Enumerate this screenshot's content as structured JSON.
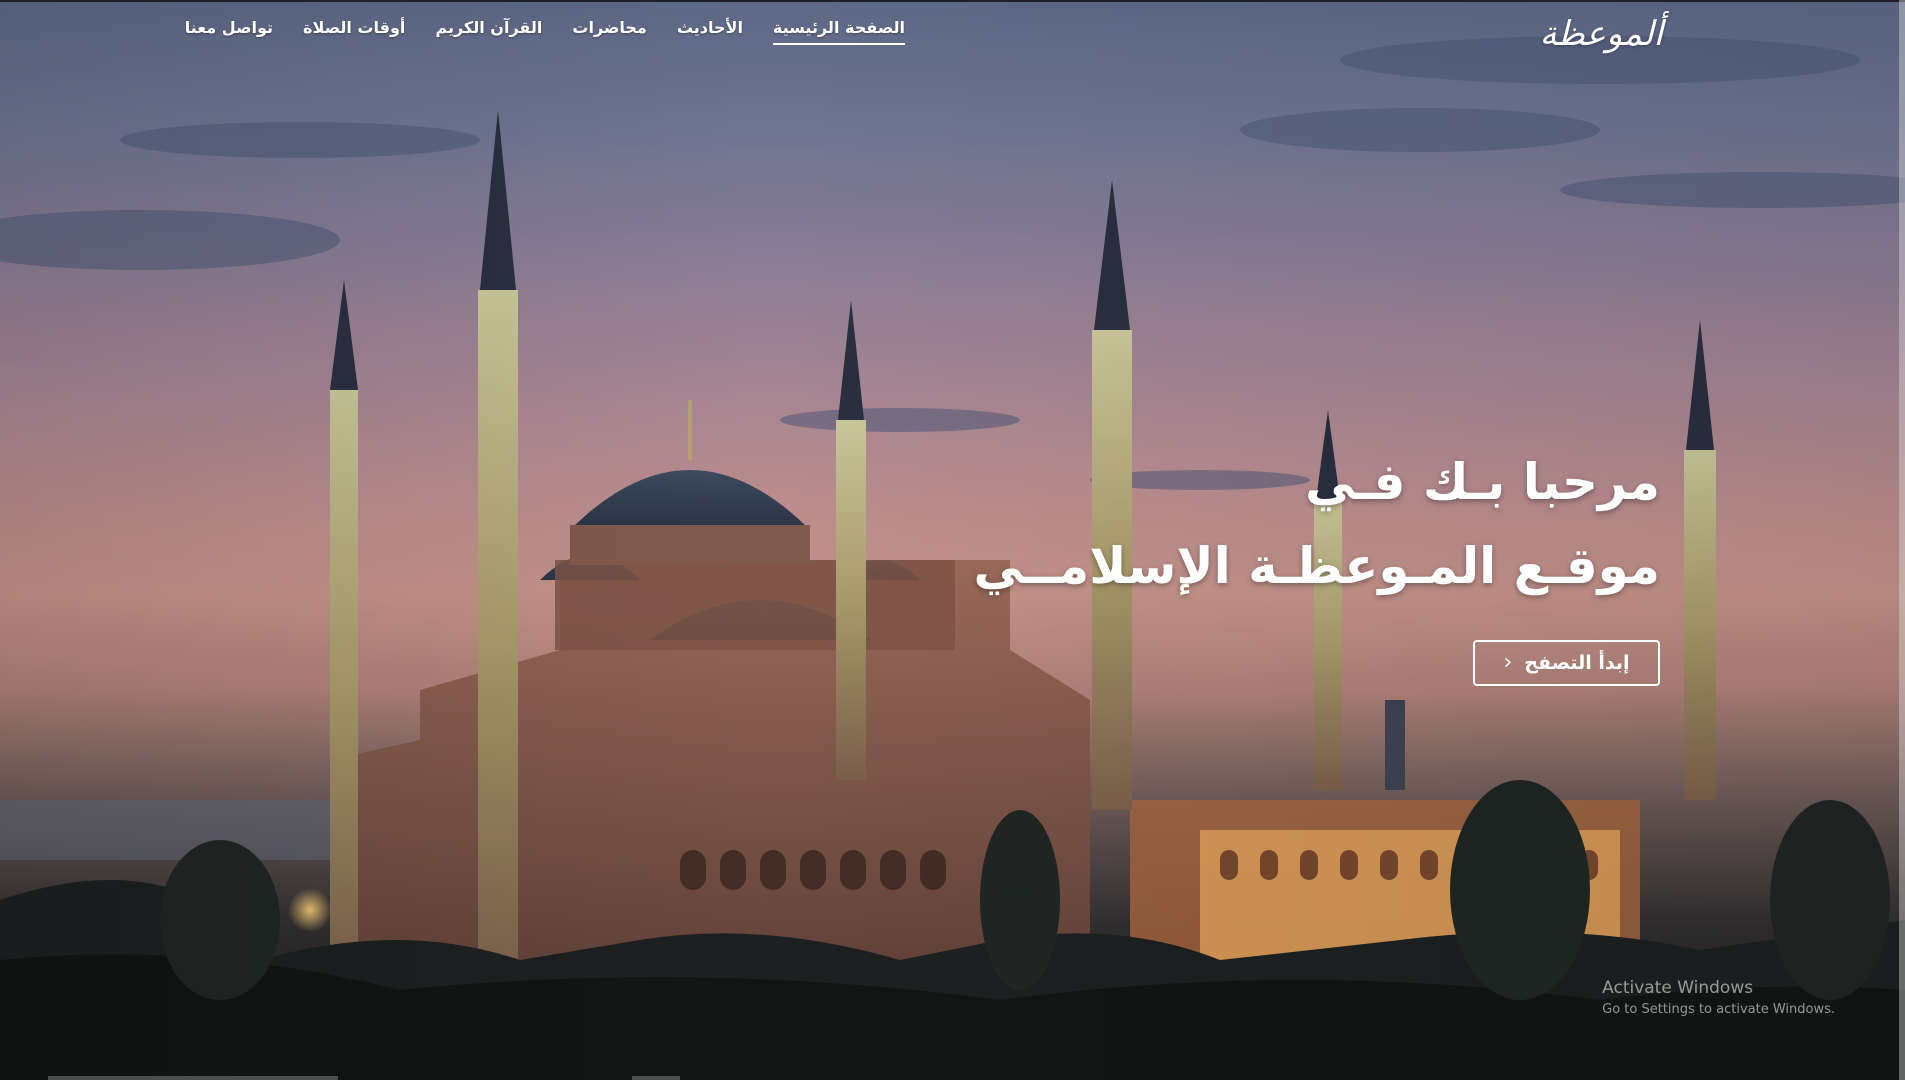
{
  "brand": {
    "logo_text": "ألموعظة"
  },
  "nav": {
    "items": [
      {
        "label": "الصفحة الرئيسية",
        "active": true
      },
      {
        "label": "الأحاديث",
        "active": false
      },
      {
        "label": "محاضرات",
        "active": false
      },
      {
        "label": "القرآن الكريم",
        "active": false
      },
      {
        "label": "أوقات الصلاة",
        "active": false
      },
      {
        "label": "تواصل معنا",
        "active": false
      }
    ]
  },
  "hero": {
    "title_line_1": "مرحبا بـك فـي",
    "title_line_2": "موقـع المـوعظـة الإسلامــي",
    "cta_label": "إبدأ التصفح",
    "cta_icon": "chevron-left-icon"
  },
  "watermark": {
    "title": "Activate Windows",
    "subtitle": "Go to Settings to activate Windows."
  },
  "colors": {
    "sky_top": "#5d6886",
    "sky_bottom": "#c39289",
    "text": "#ffffff",
    "mosque_stone": "#8a5a4c",
    "lights": "#f1c070"
  }
}
